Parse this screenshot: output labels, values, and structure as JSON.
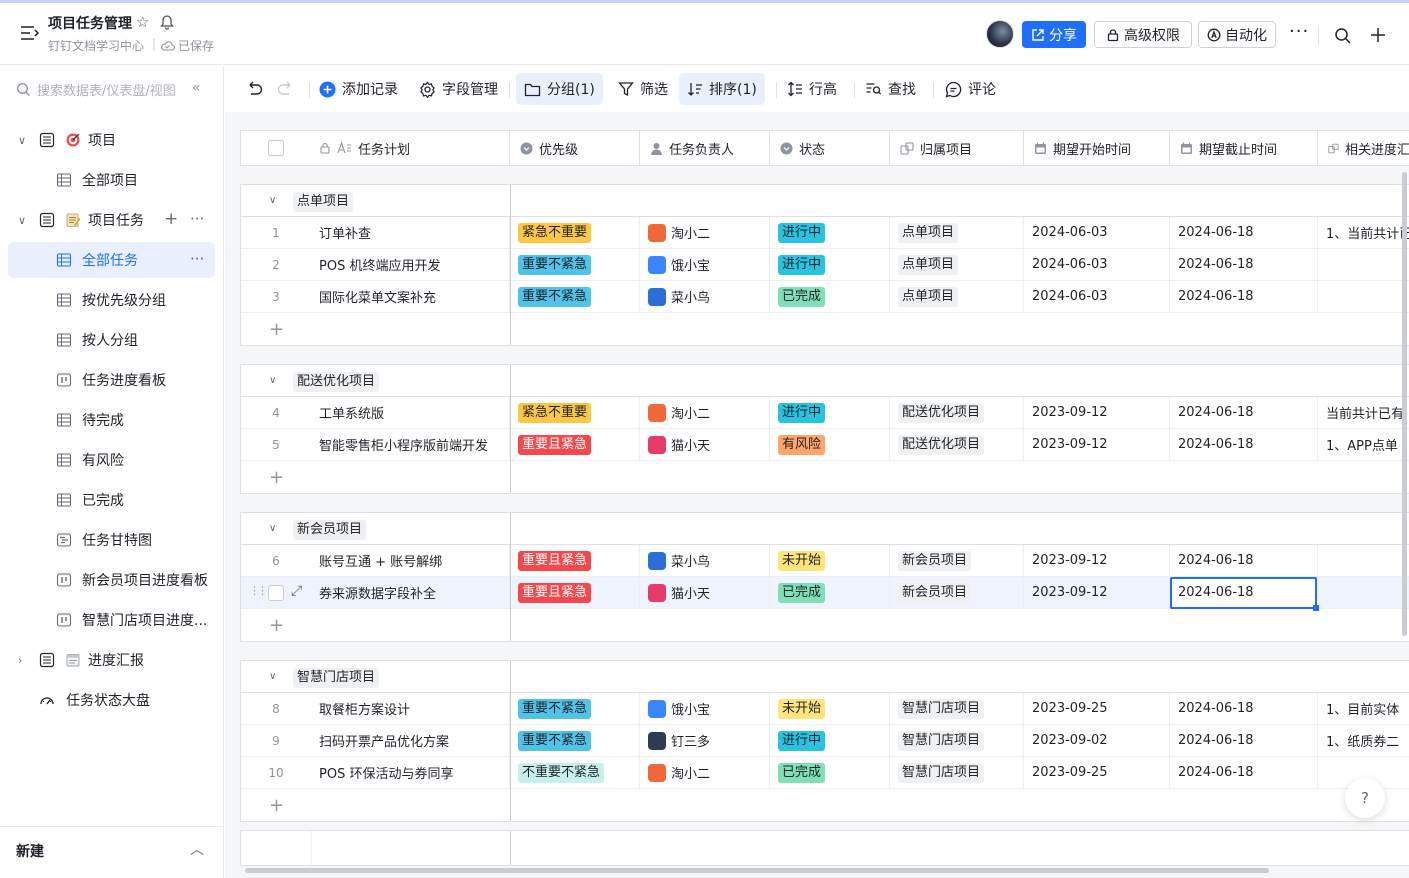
{
  "header": {
    "title": "项目任务管理",
    "breadcrumb": "钉钉文档学习中心",
    "saved": "已保存",
    "share": "分享",
    "permission": "高级权限",
    "automation": "自动化",
    "more": "···"
  },
  "sidebar": {
    "search_placeholder": "搜索数据表/仪表盘/视图",
    "collapse": "«",
    "items": [
      {
        "label": "项目"
      },
      {
        "label": "全部项目"
      },
      {
        "label": "项目任务"
      },
      {
        "label": "全部任务"
      },
      {
        "label": "按优先级分组"
      },
      {
        "label": "按人分组"
      },
      {
        "label": "任务进度看板"
      },
      {
        "label": "待完成"
      },
      {
        "label": "有风险"
      },
      {
        "label": "已完成"
      },
      {
        "label": "任务甘特图"
      },
      {
        "label": "新会员项目进度看板"
      },
      {
        "label": "智慧门店项目进度..."
      },
      {
        "label": "进度汇报"
      },
      {
        "label": "任务状态大盘"
      }
    ],
    "new_label": "新建"
  },
  "toolbar": {
    "add_record": "添加记录",
    "field_manage": "字段管理",
    "group": "分组(1)",
    "filter": "筛选",
    "sort": "排序(1)",
    "row_height": "行高",
    "find": "查找",
    "comment": "评论"
  },
  "columns": [
    "任务计划",
    "优先级",
    "任务负责人",
    "状态",
    "归属项目",
    "期望开始时间",
    "期望截止时间",
    "相关进度汇"
  ],
  "colors": {
    "accent": "#1e6fff",
    "priority_urgent_not_important": "#fcc844",
    "priority_important_not_urgent": "#4fc4e8",
    "priority_important_and_urgent": "#f5484c",
    "priority_neither": "#c8f0ea",
    "status_in_progress": "#27c3df",
    "status_done": "#7fe0b8",
    "status_risk": "#ffa56a",
    "status_not_started": "#ffe47a"
  },
  "groups": [
    {
      "name": "点单项目",
      "rows": [
        {
          "num": "1",
          "task": "订单补查",
          "priority": "紧急不重要",
          "pcolor": "#fcc844",
          "pfont": "#1f2329",
          "owner": "淘小二",
          "avatar": "#f0683a",
          "status": "进行中",
          "scolor": "#27c3df",
          "project": "点单项目",
          "start": "2024-06-03",
          "end": "2024-06-18",
          "progress": "1、当前共计已"
        },
        {
          "num": "2",
          "task": "POS 机终端应用开发",
          "priority": "重要不紧急",
          "pcolor": "#4fc4e8",
          "pfont": "#1f2329",
          "owner": "饿小宝",
          "avatar": "#3a86ff",
          "status": "进行中",
          "scolor": "#27c3df",
          "project": "点单项目",
          "start": "2024-06-03",
          "end": "2024-06-18",
          "progress": ""
        },
        {
          "num": "3",
          "task": "国际化菜单文案补充",
          "priority": "重要不紧急",
          "pcolor": "#4fc4e8",
          "pfont": "#1f2329",
          "owner": "菜小鸟",
          "avatar": "#2b6fd6",
          "status": "已完成",
          "scolor": "#7fe0b8",
          "project": "点单项目",
          "start": "2024-06-03",
          "end": "2024-06-18",
          "progress": ""
        }
      ]
    },
    {
      "name": "配送优化项目",
      "rows": [
        {
          "num": "4",
          "task": "工单系统版",
          "priority": "紧急不重要",
          "pcolor": "#fcc844",
          "pfont": "#1f2329",
          "owner": "淘小二",
          "avatar": "#f0683a",
          "status": "进行中",
          "scolor": "#27c3df",
          "project": "配送优化项目",
          "start": "2023-09-12",
          "end": "2024-06-18",
          "progress": "当前共计已有"
        },
        {
          "num": "5",
          "task": "智能零售柜小程序版前端开发",
          "priority": "重要且紧急",
          "pcolor": "#f5484c",
          "pfont": "#ffffff",
          "owner": "猫小天",
          "avatar": "#e8396b",
          "status": "有风险",
          "scolor": "#ffa56a",
          "project": "配送优化项目",
          "start": "2023-09-12",
          "end": "2024-06-18",
          "progress": "1、APP点单"
        }
      ]
    },
    {
      "name": "新会员项目",
      "rows": [
        {
          "num": "6",
          "task": "账号互通 + 账号解绑",
          "priority": "重要且紧急",
          "pcolor": "#f5484c",
          "pfont": "#ffffff",
          "owner": "菜小鸟",
          "avatar": "#2b6fd6",
          "status": "未开始",
          "scolor": "#ffe47a",
          "project": "新会员项目",
          "start": "2023-09-12",
          "end": "2024-06-18",
          "progress": ""
        },
        {
          "num": "",
          "task": "券来源数据字段补全",
          "priority": "重要且紧急",
          "pcolor": "#f5484c",
          "pfont": "#ffffff",
          "owner": "猫小天",
          "avatar": "#e8396b",
          "status": "已完成",
          "scolor": "#7fe0b8",
          "project": "新会员项目",
          "start": "2023-09-12",
          "end": "2024-06-18",
          "progress": "",
          "selected": true
        }
      ]
    },
    {
      "name": "智慧门店项目",
      "rows": [
        {
          "num": "8",
          "task": "取餐柜方案设计",
          "priority": "重要不紧急",
          "pcolor": "#4fc4e8",
          "pfont": "#1f2329",
          "owner": "饿小宝",
          "avatar": "#3a86ff",
          "status": "未开始",
          "scolor": "#ffe47a",
          "project": "智慧门店项目",
          "start": "2023-09-25",
          "end": "2024-06-18",
          "progress": "1、目前实体"
        },
        {
          "num": "9",
          "task": "扫码开票产品优化方案",
          "priority": "重要不紧急",
          "pcolor": "#4fc4e8",
          "pfont": "#1f2329",
          "owner": "钉三多",
          "avatar": "#2f3b52",
          "status": "进行中",
          "scolor": "#27c3df",
          "project": "智慧门店项目",
          "start": "2023-09-02",
          "end": "2024-06-18",
          "progress": "1、纸质券二"
        },
        {
          "num": "10",
          "task": "POS 环保活动与券同享",
          "priority": "不重要不紧急",
          "pcolor": "#c8f0ea",
          "pfont": "#1f2329",
          "owner": "淘小二",
          "avatar": "#f0683a",
          "status": "已完成",
          "scolor": "#7fe0b8",
          "project": "智慧门店项目",
          "start": "2023-09-25",
          "end": "2024-06-18",
          "progress": ""
        }
      ]
    }
  ],
  "help": "?"
}
